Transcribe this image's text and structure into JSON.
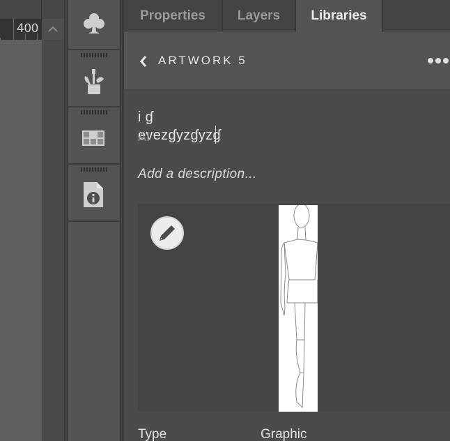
{
  "canvas": {
    "zoom_readout": "400",
    "scroll_up_icon": "chevron-up-icon"
  },
  "dock": {
    "items": [
      {
        "name": "symbols",
        "icon": "club-icon"
      },
      {
        "name": "brushes",
        "icon": "brushes-icon"
      },
      {
        "name": "swatches",
        "icon": "swatch-grid-icon"
      },
      {
        "name": "document-info",
        "icon": "document-info-icon"
      }
    ]
  },
  "panel": {
    "tabs": [
      {
        "label": "Properties",
        "active": false
      },
      {
        "label": "Layers",
        "active": false
      },
      {
        "label": "Libraries",
        "active": true
      }
    ],
    "header": {
      "back_icon": "chevron-left-icon",
      "title": "ARTWORK 5",
      "more_icon": "more-horizontal-icon"
    },
    "asset": {
      "name": "i ɠ evezɠyzɠyzɠ",
      "source": "AI",
      "description_placeholder": "Add a description...",
      "edit_icon": "pencil-icon",
      "preview": "fashion-croquis-figure",
      "properties": [
        {
          "label": "Type",
          "value": "Graphic"
        }
      ]
    }
  }
}
